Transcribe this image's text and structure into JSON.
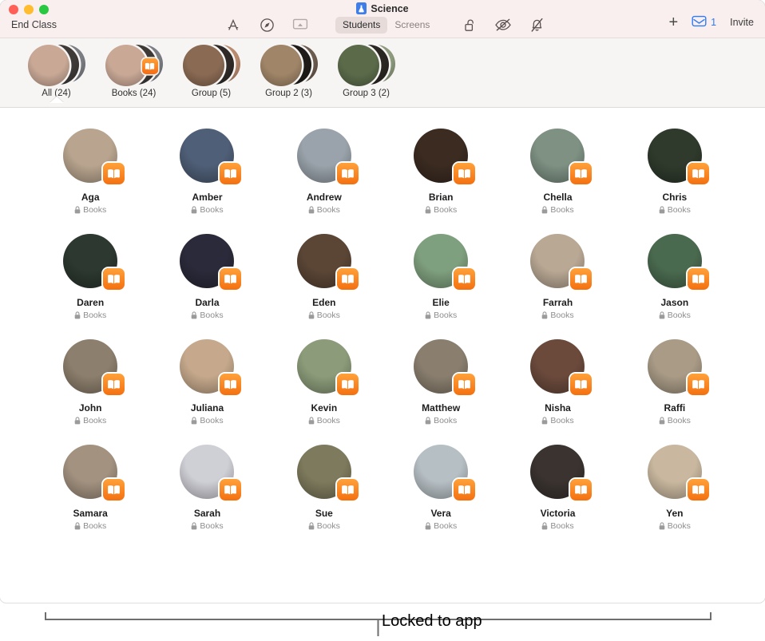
{
  "window": {
    "title": "Science",
    "title_icon": "science-app-icon",
    "end_class_label": "End Class",
    "traffic_lights": [
      "close",
      "minimize",
      "zoom"
    ]
  },
  "toolbar": {
    "left_icons": [
      {
        "name": "app-store-icon",
        "label": "Apps"
      },
      {
        "name": "safari-icon",
        "label": "Navigate"
      },
      {
        "name": "airplay-screen-icon",
        "label": "Screen View"
      }
    ],
    "segmented_control": {
      "options": [
        "Students",
        "Screens"
      ],
      "selected": "Students"
    },
    "action_icons": [
      {
        "name": "lock-open-icon",
        "label": "Lock"
      },
      {
        "name": "eye-slash-icon",
        "label": "Hide Screen"
      },
      {
        "name": "bell-slash-icon",
        "label": "Mute"
      }
    ],
    "add_label": "+",
    "inbox_count": "1",
    "inbox_icon": "inbox-tray-icon",
    "invite_label": "Invite"
  },
  "groups": {
    "selected": "All (24)",
    "items": [
      {
        "label": "All (24)",
        "has_app_badge": false,
        "colors": [
          "#c9a896",
          "#3e3a38",
          "#7a7d82"
        ]
      },
      {
        "label": "Books (24)",
        "has_app_badge": true,
        "badge_icon": "books-app-icon",
        "colors": [
          "#c9a896",
          "#3e3a38",
          "#7a7d82"
        ]
      },
      {
        "label": "Group (5)",
        "has_app_badge": false,
        "colors": [
          "#8a6a53",
          "#2f2a27",
          "#b98a6e"
        ]
      },
      {
        "label": "Group 2 (3)",
        "has_app_badge": false,
        "colors": [
          "#a08568",
          "#1f1b19",
          "#6b5a4e"
        ]
      },
      {
        "label": "Group 3 (2)",
        "has_app_badge": false,
        "colors": [
          "#5b6b4a",
          "#2a2622",
          "#8d9a7d"
        ]
      }
    ]
  },
  "students": {
    "status_label": "Books",
    "status_icon": "lock-closed-icon",
    "badge_icon": "books-app-icon",
    "list": [
      {
        "name": "Aga",
        "avatar": "#b9a58f"
      },
      {
        "name": "Amber",
        "avatar": "#4f5f77"
      },
      {
        "name": "Andrew",
        "avatar": "#9aa3ab"
      },
      {
        "name": "Brian",
        "avatar": "#3b2b21"
      },
      {
        "name": "Chella",
        "avatar": "#7e9183"
      },
      {
        "name": "Chris",
        "avatar": "#2f3a2c"
      },
      {
        "name": "Daren",
        "avatar": "#2c3830"
      },
      {
        "name": "Darla",
        "avatar": "#2b2a3a"
      },
      {
        "name": "Eden",
        "avatar": "#5b4636"
      },
      {
        "name": "Elie",
        "avatar": "#7fa07e"
      },
      {
        "name": "Farrah",
        "avatar": "#b9a894"
      },
      {
        "name": "Jason",
        "avatar": "#4a6a4f"
      },
      {
        "name": "John",
        "avatar": "#8d7f6d"
      },
      {
        "name": "Juliana",
        "avatar": "#c6a98c"
      },
      {
        "name": "Kevin",
        "avatar": "#8c9c7a"
      },
      {
        "name": "Matthew",
        "avatar": "#8a7f6f"
      },
      {
        "name": "Nisha",
        "avatar": "#6b4a3c"
      },
      {
        "name": "Raffi",
        "avatar": "#a99b86"
      },
      {
        "name": "Samara",
        "avatar": "#a39280"
      },
      {
        "name": "Sarah",
        "avatar": "#cfcfd6"
      },
      {
        "name": "Sue",
        "avatar": "#7e7a5d"
      },
      {
        "name": "Vera",
        "avatar": "#b6bfc4"
      },
      {
        "name": "Victoria",
        "avatar": "#3a3330"
      },
      {
        "name": "Yen",
        "avatar": "#c9b89f"
      }
    ]
  },
  "annotation": {
    "caption": "Locked to app"
  },
  "colors": {
    "titlebar_bg": "#f9efee",
    "groups_bg": "#f7f5f4",
    "accent_blue": "#2e7bf6",
    "badge_orange": "#f4700f",
    "content_bg": "#ffffff"
  }
}
